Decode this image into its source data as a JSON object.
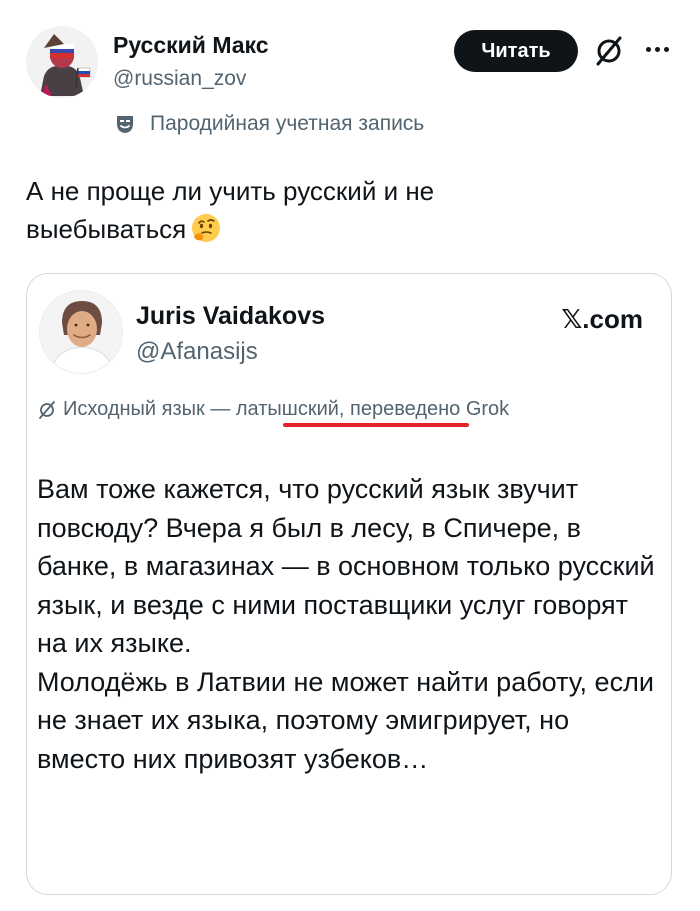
{
  "author": {
    "name": "Русский Макс",
    "handle": "@russian_zov",
    "parody_label": "Пародийная учетная запись"
  },
  "follow_button": {
    "label": "Читать"
  },
  "icons": {
    "grok": "grok-icon",
    "more": "more-icon",
    "mask": "mask-icon"
  },
  "tweet": {
    "text": "А не проще ли учить русский и не выебываться",
    "emoji": "thinking-face"
  },
  "quote": {
    "author_name": "Juris Vaidakovs",
    "author_handle": "@Afanasijs",
    "source": "𝕏.com",
    "translation_note": "Исходный язык — латышский, переведено Grok",
    "body": "Вам тоже кажется, что русский язык звучит повсюду? Вчера я был в лесу, в Спичере, в банке, в магазинах — в основном только русский язык, и везде с ними поставщики услуг говорят на их языке.\nМолодёжь в Латвии не может найти работу, если не знает их языка, поэтому эмигрирует, но вместо них привозят узбеков…"
  },
  "colors": {
    "text_primary": "#0f1419",
    "text_secondary": "#536471",
    "button_bg": "#0f1419",
    "card_border": "#cfd9de",
    "highlight_underline": "#e8222b"
  }
}
